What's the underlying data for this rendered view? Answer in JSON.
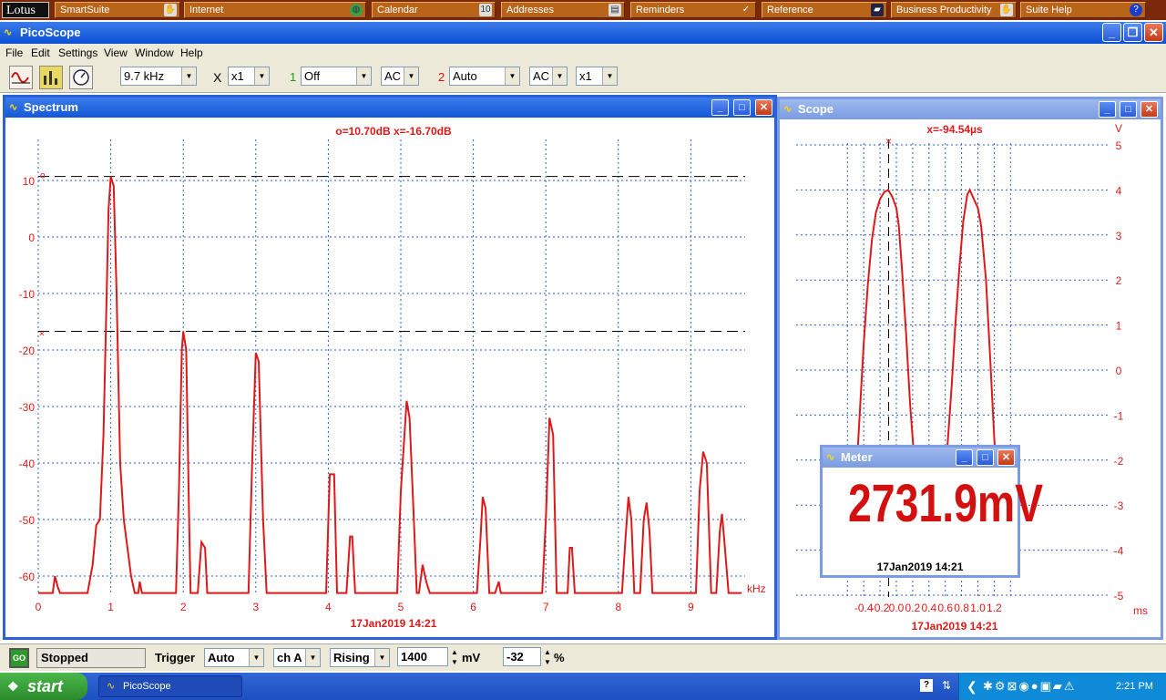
{
  "lotus": {
    "logo": "Lotus",
    "buttons": [
      {
        "label": "SmartSuite",
        "icon": "hand-icon"
      },
      {
        "label": "Internet",
        "icon": "globe-icon"
      },
      {
        "label": "Calendar",
        "icon": "calendar-icon"
      },
      {
        "label": "Addresses",
        "icon": "address-card-icon"
      },
      {
        "label": "Reminders",
        "icon": "checkmark-icon"
      },
      {
        "label": "Reference",
        "icon": "book-icon"
      },
      {
        "label": "Business Productivity",
        "icon": "hand-icon"
      },
      {
        "label": "Suite Help",
        "icon": "help-icon"
      }
    ]
  },
  "window": {
    "title": "PicoScope"
  },
  "menu": [
    "File",
    "Edit",
    "Settings",
    "View",
    "Window",
    "Help"
  ],
  "toolbar": {
    "timebase": "9.7 kHz",
    "mult_symbol": "X",
    "multiplier": "x1",
    "ch1_label": "1",
    "ch1_range": "Off",
    "ch1_coupling": "AC",
    "ch2_label": "2",
    "ch2_range": "Auto",
    "ch2_coupling": "AC",
    "ch2_mult": "x1"
  },
  "spectrum": {
    "title": "Spectrum",
    "readout": "o=10.70dB  x=-16.70dB",
    "x_unit": "kHz",
    "timestamp": "17Jan2019  14:21"
  },
  "scope": {
    "title": "Scope",
    "readout": "x=-94.54µs",
    "y_unit": "V",
    "x_unit": "ms",
    "timestamp": "17Jan2019  14:21"
  },
  "meter": {
    "title": "Meter",
    "value": "2731.9mV",
    "timestamp": "17Jan2019  14:21"
  },
  "status": {
    "go": "GO",
    "state": "Stopped",
    "trigger_label": "Trigger",
    "trigger_mode": "Auto",
    "trigger_channel": "ch A",
    "trigger_edge": "Rising",
    "trigger_level": "1400",
    "level_unit": "mV",
    "pretrigger": "-32",
    "pre_unit": "%"
  },
  "taskbar": {
    "start": "start",
    "task": "PicoScope",
    "clock": "2:21 PM"
  },
  "colors": {
    "trace": "#dd1a1a",
    "grid": "#2b63c8",
    "titlebar": "#0b4fd4"
  },
  "chart_data": [
    {
      "type": "line",
      "title": "",
      "xlabel": "kHz",
      "ylabel": "",
      "xlim": [
        0,
        9.7
      ],
      "ylim": [
        -63,
        12
      ],
      "x_ticks": [
        "0",
        "1",
        "2",
        "3",
        "4",
        "5",
        "6",
        "7",
        "8",
        "9"
      ],
      "y_ticks": [
        "10",
        "0",
        "-10",
        "-20",
        "-30",
        "-40",
        "-50",
        "-60"
      ],
      "markers": {
        "o": 10.7,
        "x": -16.7
      },
      "series": [
        {
          "points": [
            [
              0,
              -63
            ],
            [
              0.2,
              -63
            ],
            [
              0.23,
              -60
            ],
            [
              0.27,
              -62
            ],
            [
              0.3,
              -63
            ],
            [
              0.68,
              -63
            ],
            [
              0.75,
              -58
            ],
            [
              0.8,
              -51
            ],
            [
              0.85,
              -50
            ],
            [
              0.9,
              -35
            ],
            [
              0.97,
              5
            ],
            [
              1.0,
              10.7
            ],
            [
              1.04,
              9
            ],
            [
              1.08,
              -10
            ],
            [
              1.13,
              -40
            ],
            [
              1.18,
              -50
            ],
            [
              1.23,
              -55
            ],
            [
              1.28,
              -60
            ],
            [
              1.33,
              -63
            ],
            [
              1.38,
              -63
            ],
            [
              1.4,
              -61
            ],
            [
              1.43,
              -63
            ],
            [
              1.9,
              -63
            ],
            [
              1.94,
              -45
            ],
            [
              1.98,
              -20
            ],
            [
              2.0,
              -16.7
            ],
            [
              2.04,
              -20
            ],
            [
              2.08,
              -50
            ],
            [
              2.1,
              -63
            ],
            [
              2.2,
              -63
            ],
            [
              2.25,
              -54
            ],
            [
              2.3,
              -55
            ],
            [
              2.33,
              -63
            ],
            [
              2.9,
              -63
            ],
            [
              2.95,
              -40
            ],
            [
              3.0,
              -20.5
            ],
            [
              3.04,
              -22
            ],
            [
              3.1,
              -50
            ],
            [
              3.15,
              -63
            ],
            [
              3.97,
              -63
            ],
            [
              4.02,
              -42
            ],
            [
              4.08,
              -42
            ],
            [
              4.12,
              -63
            ],
            [
              4.25,
              -63
            ],
            [
              4.3,
              -53
            ],
            [
              4.33,
              -53
            ],
            [
              4.37,
              -63
            ],
            [
              4.95,
              -63
            ],
            [
              5.0,
              -45
            ],
            [
              5.08,
              -29
            ],
            [
              5.12,
              -32
            ],
            [
              5.18,
              -50
            ],
            [
              5.22,
              -63
            ],
            [
              5.25,
              -63
            ],
            [
              5.3,
              -58
            ],
            [
              5.35,
              -61
            ],
            [
              5.4,
              -63
            ],
            [
              6.05,
              -63
            ],
            [
              6.1,
              -53
            ],
            [
              6.13,
              -46
            ],
            [
              6.17,
              -48
            ],
            [
              6.22,
              -63
            ],
            [
              6.3,
              -63
            ],
            [
              6.35,
              -61
            ],
            [
              6.38,
              -63
            ],
            [
              6.95,
              -63
            ],
            [
              7.0,
              -50
            ],
            [
              7.05,
              -32
            ],
            [
              7.1,
              -35
            ],
            [
              7.15,
              -63
            ],
            [
              7.3,
              -63
            ],
            [
              7.33,
              -55
            ],
            [
              7.36,
              -55
            ],
            [
              7.4,
              -63
            ],
            [
              8.05,
              -63
            ],
            [
              8.1,
              -53
            ],
            [
              8.14,
              -46
            ],
            [
              8.18,
              -50
            ],
            [
              8.22,
              -63
            ],
            [
              8.3,
              -63
            ],
            [
              8.35,
              -50
            ],
            [
              8.39,
              -47
            ],
            [
              8.43,
              -52
            ],
            [
              8.47,
              -63
            ],
            [
              9.07,
              -63
            ],
            [
              9.12,
              -45
            ],
            [
              9.17,
              -38
            ],
            [
              9.22,
              -40
            ],
            [
              9.28,
              -63
            ],
            [
              9.35,
              -63
            ],
            [
              9.4,
              -52
            ],
            [
              9.43,
              -49
            ],
            [
              9.47,
              -55
            ],
            [
              9.52,
              -63
            ],
            [
              9.7,
              -63
            ]
          ]
        }
      ]
    },
    {
      "type": "line",
      "title": "",
      "xlabel": "ms",
      "ylabel": "V",
      "xlim": [
        -0.6,
        1.4
      ],
      "ylim": [
        -5,
        5
      ],
      "x_ticks": [
        "-0.4",
        "-0.2",
        "0.0",
        "0.2",
        "0.4",
        "0.6",
        "0.8",
        "1.0",
        "1.2"
      ],
      "y_ticks": [
        "5",
        "4",
        "3",
        "2",
        "1",
        "0",
        "-1",
        "-2",
        "-3",
        "-4",
        "-5"
      ],
      "markers": {
        "x": -0.09454
      },
      "series": [
        {
          "points": [
            [
              -0.6,
              -3.6
            ],
            [
              -0.55,
              -3.4
            ],
            [
              -0.5,
              -2.6
            ],
            [
              -0.45,
              -1.0
            ],
            [
              -0.4,
              0.6
            ],
            [
              -0.35,
              1.9
            ],
            [
              -0.3,
              2.9
            ],
            [
              -0.25,
              3.5
            ],
            [
              -0.2,
              3.8
            ],
            [
              -0.15,
              3.95
            ],
            [
              -0.1,
              4.0
            ],
            [
              -0.05,
              3.85
            ],
            [
              0.0,
              3.6
            ],
            [
              0.03,
              3.2
            ],
            [
              0.07,
              2.2
            ],
            [
              0.12,
              0.8
            ],
            [
              0.17,
              -0.8
            ],
            [
              0.22,
              -2.0
            ],
            [
              0.3,
              -3.2
            ],
            [
              0.4,
              -3.6
            ],
            [
              0.5,
              -3.5
            ],
            [
              0.58,
              -2.8
            ],
            [
              0.63,
              -1.6
            ],
            [
              0.68,
              -0.3
            ],
            [
              0.72,
              0.9
            ],
            [
              0.77,
              2.2
            ],
            [
              0.82,
              3.3
            ],
            [
              0.87,
              3.9
            ],
            [
              0.9,
              4.0
            ],
            [
              0.95,
              3.8
            ],
            [
              1.0,
              3.6
            ],
            [
              1.04,
              3.2
            ],
            [
              1.1,
              2.0
            ],
            [
              1.15,
              0.3
            ],
            [
              1.2,
              -1.5
            ],
            [
              1.25,
              -2.8
            ],
            [
              1.3,
              -3.5
            ],
            [
              1.33,
              -3.65
            ]
          ]
        }
      ]
    }
  ]
}
